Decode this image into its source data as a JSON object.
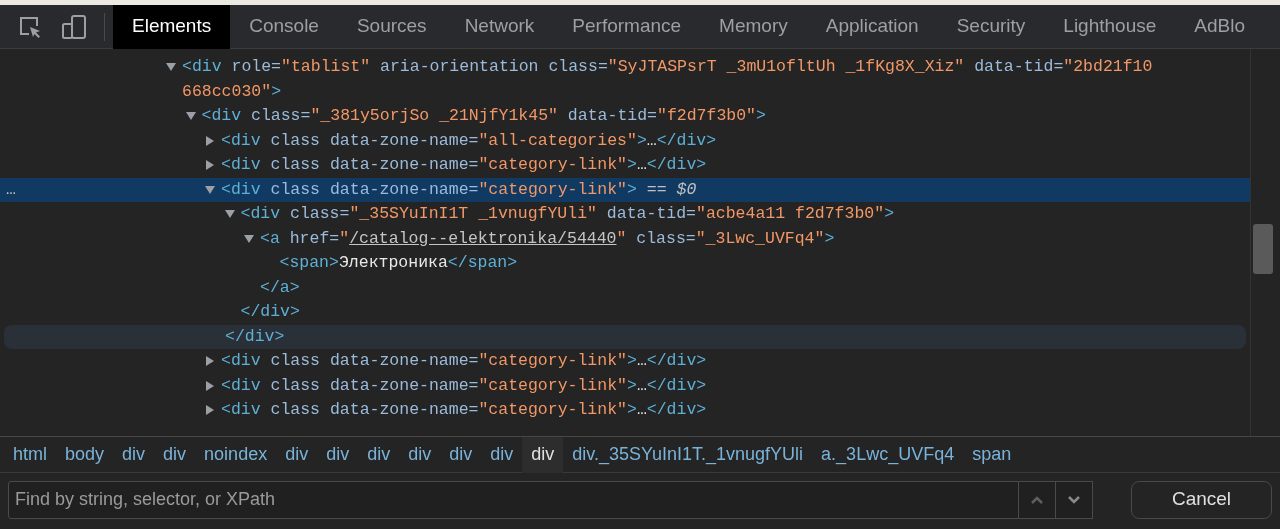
{
  "toolbar": {
    "tabs": [
      {
        "label": "Elements",
        "selected": true
      },
      {
        "label": "Console",
        "selected": false
      },
      {
        "label": "Sources",
        "selected": false
      },
      {
        "label": "Network",
        "selected": false
      },
      {
        "label": "Performance",
        "selected": false
      },
      {
        "label": "Memory",
        "selected": false
      },
      {
        "label": "Application",
        "selected": false
      },
      {
        "label": "Security",
        "selected": false
      },
      {
        "label": "Lighthouse",
        "selected": false
      },
      {
        "label": "AdBlo",
        "selected": false
      }
    ]
  },
  "dom_tree": [
    {
      "kind": "element",
      "expanded": true,
      "selected": false,
      "hovered": false,
      "open": [
        {
          "kind": "tag",
          "text": "<div"
        },
        {
          "kind": "attr",
          "text": " role="
        },
        {
          "kind": "value",
          "text": "\"tablist\""
        },
        {
          "kind": "attr",
          "text": " aria-orientation class="
        },
        {
          "kind": "value",
          "text": "\"SyJTASPsrT _3mU1ofltUh _1fKg8X_Xiz\""
        },
        {
          "kind": "attr",
          "text": " data-tid="
        },
        {
          "kind": "value",
          "text": "\"2bd21f10 668cc030\""
        },
        {
          "kind": "tag",
          "text": ">"
        }
      ],
      "children": [
        {
          "kind": "element",
          "expanded": true,
          "selected": false,
          "hovered": false,
          "open": [
            {
              "kind": "tag",
              "text": "<div"
            },
            {
              "kind": "attr",
              "text": " class="
            },
            {
              "kind": "value",
              "text": "\"_381y5orjSo _21NjfY1k45\""
            },
            {
              "kind": "attr",
              "text": " data-tid="
            },
            {
              "kind": "value",
              "text": "\"f2d7f3b0\""
            },
            {
              "kind": "tag",
              "text": ">"
            }
          ],
          "children": [
            {
              "kind": "element",
              "expanded": false,
              "selected": false,
              "hovered": false,
              "open": [
                {
                  "kind": "tag",
                  "text": "<div"
                },
                {
                  "kind": "attr",
                  "text": " class data-zone-name="
                },
                {
                  "kind": "value",
                  "text": "\"all-categories\""
                },
                {
                  "kind": "tag",
                  "text": ">"
                },
                {
                  "kind": "text",
                  "text": "…"
                },
                {
                  "kind": "tag",
                  "text": "</div>"
                }
              ]
            },
            {
              "kind": "element",
              "expanded": false,
              "selected": false,
              "hovered": false,
              "open": [
                {
                  "kind": "tag",
                  "text": "<div"
                },
                {
                  "kind": "attr",
                  "text": " class data-zone-name="
                },
                {
                  "kind": "value",
                  "text": "\"category-link\""
                },
                {
                  "kind": "tag",
                  "text": ">"
                },
                {
                  "kind": "text",
                  "text": "…"
                },
                {
                  "kind": "tag",
                  "text": "</div>"
                }
              ]
            },
            {
              "kind": "element",
              "expanded": true,
              "selected": true,
              "hovered": true,
              "gutter_mark": "…",
              "open": [
                {
                  "kind": "tag",
                  "text": "<div"
                },
                {
                  "kind": "attr",
                  "text": " class data-zone-name="
                },
                {
                  "kind": "value",
                  "text": "\"category-link\""
                },
                {
                  "kind": "tag",
                  "text": ">"
                },
                {
                  "kind": "marker",
                  "text": " == $0"
                }
              ],
              "children": [
                {
                  "kind": "element",
                  "expanded": true,
                  "selected": false,
                  "hovered": false,
                  "open": [
                    {
                      "kind": "tag",
                      "text": "<div"
                    },
                    {
                      "kind": "attr",
                      "text": " class="
                    },
                    {
                      "kind": "value",
                      "text": "\"_35SYuInI1T _1vnugfYUli\""
                    },
                    {
                      "kind": "attr",
                      "text": " data-tid="
                    },
                    {
                      "kind": "value",
                      "text": "\"acbe4a11 f2d7f3b0\""
                    },
                    {
                      "kind": "tag",
                      "text": ">"
                    }
                  ],
                  "children": [
                    {
                      "kind": "element",
                      "expanded": true,
                      "selected": false,
                      "hovered": false,
                      "open": [
                        {
                          "kind": "tag",
                          "text": "<a"
                        },
                        {
                          "kind": "attr",
                          "text": " href="
                        },
                        {
                          "kind": "value",
                          "text": "\""
                        },
                        {
                          "kind": "link",
                          "text": "/catalog--elektronika/54440"
                        },
                        {
                          "kind": "value",
                          "text": "\""
                        },
                        {
                          "kind": "attr",
                          "text": " class="
                        },
                        {
                          "kind": "value",
                          "text": "\"_3Lwc_UVFq4\""
                        },
                        {
                          "kind": "tag",
                          "text": ">"
                        }
                      ],
                      "children": [
                        {
                          "kind": "leaf",
                          "selected": false,
                          "hovered": false,
                          "open": [
                            {
                              "kind": "tag",
                              "text": "<span>"
                            },
                            {
                              "kind": "text",
                              "text": "Электроника"
                            },
                            {
                              "kind": "tag",
                              "text": "</span>"
                            }
                          ]
                        }
                      ],
                      "close": [
                        {
                          "kind": "tag",
                          "text": "</a>"
                        }
                      ]
                    }
                  ],
                  "close": [
                    {
                      "kind": "tag",
                      "text": "</div>"
                    }
                  ]
                }
              ],
              "close": [
                {
                  "kind": "tag",
                  "text": "</div>"
                }
              ]
            },
            {
              "kind": "element",
              "expanded": false,
              "selected": false,
              "hovered": false,
              "open": [
                {
                  "kind": "tag",
                  "text": "<div"
                },
                {
                  "kind": "attr",
                  "text": " class data-zone-name="
                },
                {
                  "kind": "value",
                  "text": "\"category-link\""
                },
                {
                  "kind": "tag",
                  "text": ">"
                },
                {
                  "kind": "text",
                  "text": "…"
                },
                {
                  "kind": "tag",
                  "text": "</div>"
                }
              ]
            },
            {
              "kind": "element",
              "expanded": false,
              "selected": false,
              "hovered": false,
              "open": [
                {
                  "kind": "tag",
                  "text": "<div"
                },
                {
                  "kind": "attr",
                  "text": " class data-zone-name="
                },
                {
                  "kind": "value",
                  "text": "\"category-link\""
                },
                {
                  "kind": "tag",
                  "text": ">"
                },
                {
                  "kind": "text",
                  "text": "…"
                },
                {
                  "kind": "tag",
                  "text": "</div>"
                }
              ]
            },
            {
              "kind": "element",
              "expanded": false,
              "selected": false,
              "hovered": false,
              "open": [
                {
                  "kind": "tag",
                  "text": "<div"
                },
                {
                  "kind": "attr",
                  "text": " class data-zone-name="
                },
                {
                  "kind": "value",
                  "text": "\"category-link\""
                },
                {
                  "kind": "tag",
                  "text": ">"
                },
                {
                  "kind": "text",
                  "text": "…"
                },
                {
                  "kind": "tag",
                  "text": "</div>"
                }
              ]
            }
          ]
        }
      ]
    }
  ],
  "breadcrumbs": [
    {
      "label": "html",
      "selected": false
    },
    {
      "label": "body",
      "selected": false
    },
    {
      "label": "div",
      "selected": false
    },
    {
      "label": "div",
      "selected": false
    },
    {
      "label": "noindex",
      "selected": false
    },
    {
      "label": "div",
      "selected": false
    },
    {
      "label": "div",
      "selected": false
    },
    {
      "label": "div",
      "selected": false
    },
    {
      "label": "div",
      "selected": false
    },
    {
      "label": "div",
      "selected": false
    },
    {
      "label": "div",
      "selected": false
    },
    {
      "label": "div",
      "selected": true
    },
    {
      "label": "div._35SYuInI1T._1vnugfYUli",
      "selected": false
    },
    {
      "label": "a._3Lwc_UVFq4",
      "selected": false
    },
    {
      "label": "span",
      "selected": false
    }
  ],
  "search": {
    "placeholder": "Find by string, selector, or XPath"
  },
  "cancel_button": "Cancel"
}
